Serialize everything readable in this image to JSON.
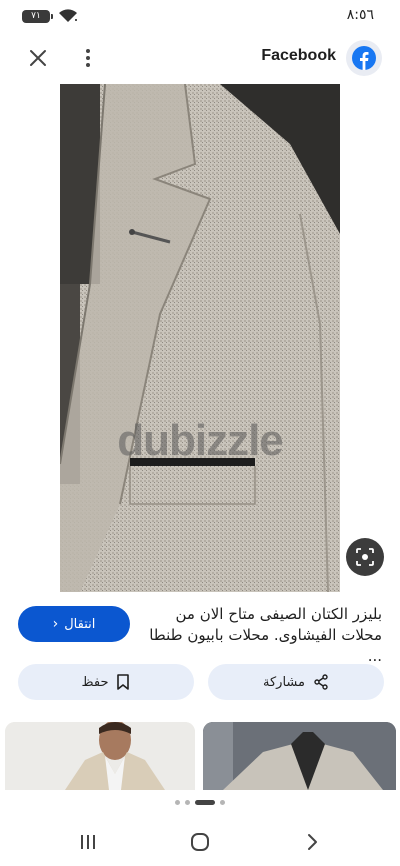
{
  "status_bar": {
    "time": "٨:٥٦",
    "battery": "٧١",
    "icons": [
      "battery-icon",
      "wifi-icon"
    ]
  },
  "header": {
    "source": "Facebook",
    "icons": [
      "close-icon",
      "more-vert-icon",
      "facebook-icon"
    ],
    "brand_color": "#1877f2"
  },
  "image": {
    "watermark": "dubizzle",
    "lens_icon": "google-lens-icon"
  },
  "result": {
    "caption": "بليزر الكتان الصيفى متاح الان من محلات الفيشاوى. محلات بابيون طنطا ...",
    "visit_label": "انتقال",
    "save_label": "حفظ",
    "share_label": "مشاركة",
    "accent_color": "#0b57d0"
  },
  "pagination": {
    "total": 4,
    "active": 2
  },
  "nav": {
    "icons": [
      "recents-icon",
      "home-icon",
      "back-icon"
    ]
  }
}
